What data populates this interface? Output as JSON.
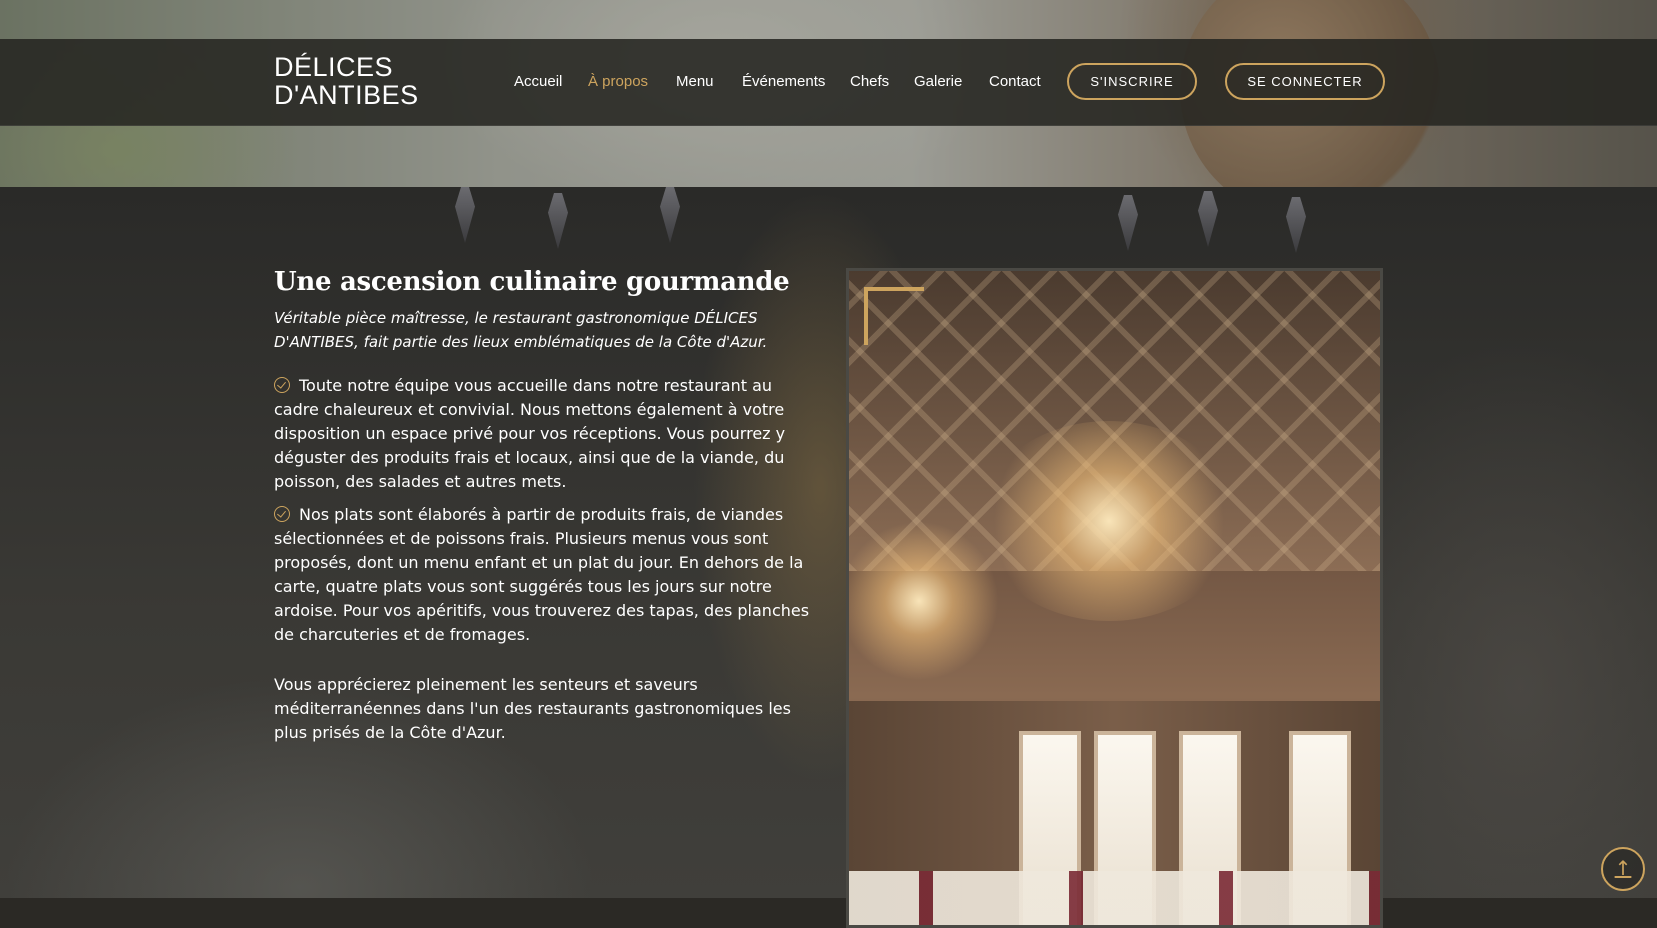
{
  "brand": {
    "line1": "DÉLICES",
    "line2": "D'ANTIBES"
  },
  "nav": {
    "items": [
      {
        "label": "Accueil",
        "active": false
      },
      {
        "label": "À propos",
        "active": true
      },
      {
        "label": "Menu",
        "active": false
      },
      {
        "label": "Événements",
        "active": false
      },
      {
        "label": "Chefs",
        "active": false
      },
      {
        "label": "Galerie",
        "active": false
      },
      {
        "label": "Contact",
        "active": false
      }
    ],
    "signup_label": "S'INSCRIRE",
    "login_label": "SE CONNECTER"
  },
  "about": {
    "title": "Une ascension culinaire gourmande",
    "lead": "Véritable pièce maîtresse, le restaurant gastronomique DÉLICES D'ANTIBES, fait partie des lieux emblématiques de la Côte d'Azur.",
    "bullets": [
      "Toute notre équipe vous accueille dans notre restaurant au cadre chaleureux et convivial. Nous mettons également à votre disposition un espace privé pour vos réceptions. Vous pourrez y déguster des produits frais et locaux, ainsi que de la viande, du poisson, des salades et autres mets.",
      "Nos plats sont élaborés à partir de produits frais, de viandes sélectionnées et de poissons frais. Plusieurs menus vous sont proposés, dont un menu enfant et un plat du jour. En dehors de la carte, quatre plats vous sont suggérés tous les jours sur notre ardoise. Pour vos apéritifs, vous trouverez des tapas, des planches de charcuteries et de fromages."
    ],
    "closing": "Vous apprécierez pleinement les senteurs et saveurs méditerranéennes dans l'un des restaurants gastronomiques les plus prisés de la Côte d'Azur."
  },
  "icons": {
    "check": "check-circle-icon",
    "back_to_top": "arrow-up-icon"
  },
  "colors": {
    "accent": "#cda45e",
    "header_bg": "#262521",
    "text": "#ffffff"
  }
}
